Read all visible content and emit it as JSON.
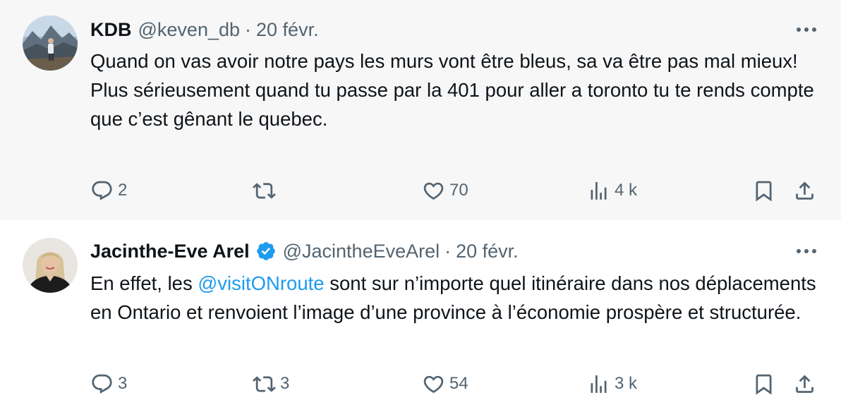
{
  "tweets": [
    {
      "author_name": "KDB",
      "handle": "@keven_db",
      "separator": "·",
      "date": "20 févr.",
      "text_line1": "Quand on vas avoir notre pays les murs vont être bleus, sa va être pas mal mieux!",
      "text_line2": "Plus sérieusement quand tu passe par la 401 pour aller a toronto tu te rends compte que c’est gênant le quebec.",
      "replies": "2",
      "retweets": "",
      "likes": "70",
      "views": "4 k"
    },
    {
      "author_name": "Jacinthe-Eve Arel",
      "verified": true,
      "handle": "@JacintheEveArel",
      "separator": "·",
      "date": "20 févr.",
      "text_before": "En effet, les ",
      "mention": "@visitONroute",
      "text_after": " sont sur n’importe quel itinéraire dans nos déplacements en Ontario et renvoient l’image d’une province à l’économie prospère et structurée.",
      "replies": "3",
      "retweets": "3",
      "likes": "54",
      "views": "3 k"
    }
  ],
  "icons": [
    "reply-icon",
    "retweet-icon",
    "like-icon",
    "views-icon",
    "bookmark-icon",
    "share-icon",
    "more-icon",
    "verified-badge-icon"
  ],
  "colors": {
    "accent": "#1d9bf0",
    "secondary_text": "#536471",
    "primary_text": "#0f1419",
    "highlight_bg": "#f7f7f7"
  }
}
